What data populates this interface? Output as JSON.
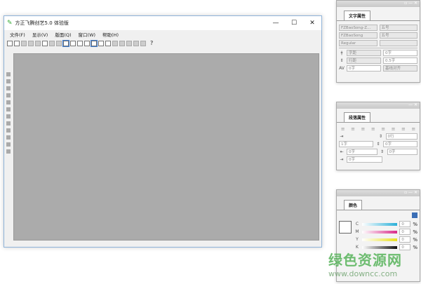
{
  "app": {
    "title": "方正飞腾创艺5.0 体验版",
    "controls": [
      "—",
      "☐",
      "✕"
    ]
  },
  "menu": [
    "文件(F)",
    "显示(V)",
    "版面(Q)",
    "窗口(W)",
    "帮助(H)"
  ],
  "panels": {
    "text": {
      "tab": "文字属性",
      "font1": "FZBaoSong-Z...",
      "font2": "FZBaoSong",
      "style": "Regular",
      "size1": "五号",
      "size2": "五号",
      "tracking": "字距",
      "tracking_val": "0字",
      "leading": "行距",
      "leading_val": "0.5字",
      "kerning": "0字",
      "align": "基线对齐"
    },
    "para": {
      "tab": "段落属性",
      "v1": "0行",
      "v2": "1字",
      "v3": "0字",
      "v4": "0字",
      "v5": "0字",
      "v6": "0字"
    },
    "color": {
      "tab": "颜色",
      "channels": [
        {
          "l": "C",
          "v": "0",
          "c": "#2ab0d8"
        },
        {
          "l": "M",
          "v": "0",
          "c": "#d82a8a"
        },
        {
          "l": "Y",
          "v": "0",
          "c": "#e8e020"
        },
        {
          "l": "K",
          "v": "0",
          "c": "#111111"
        }
      ],
      "pct": "%"
    }
  },
  "watermark": {
    "cn": "绿色资源网",
    "url": "www.downcc.com"
  }
}
